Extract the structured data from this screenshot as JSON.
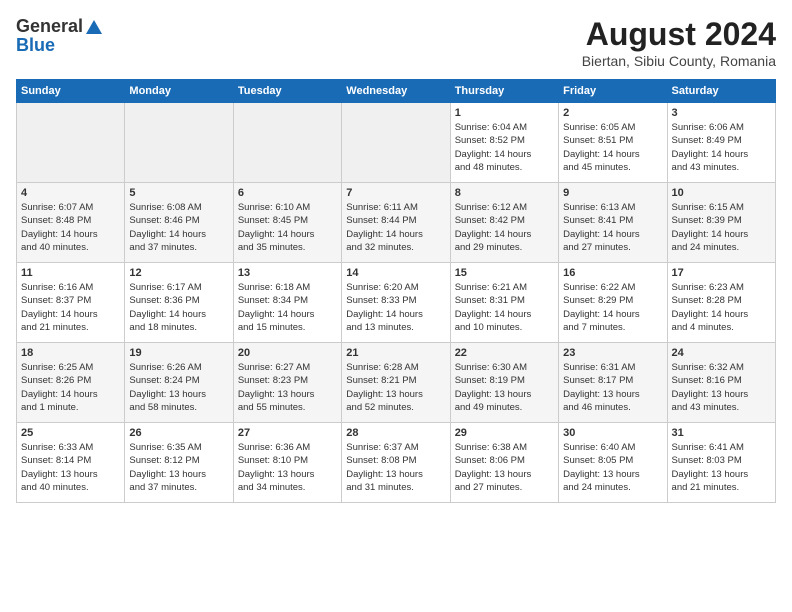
{
  "header": {
    "logo_general": "General",
    "logo_blue": "Blue",
    "month_year": "August 2024",
    "location": "Biertan, Sibiu County, Romania"
  },
  "days_of_week": [
    "Sunday",
    "Monday",
    "Tuesday",
    "Wednesday",
    "Thursday",
    "Friday",
    "Saturday"
  ],
  "weeks": [
    [
      {
        "day": "",
        "info": ""
      },
      {
        "day": "",
        "info": ""
      },
      {
        "day": "",
        "info": ""
      },
      {
        "day": "",
        "info": ""
      },
      {
        "day": "1",
        "info": "Sunrise: 6:04 AM\nSunset: 8:52 PM\nDaylight: 14 hours\nand 48 minutes."
      },
      {
        "day": "2",
        "info": "Sunrise: 6:05 AM\nSunset: 8:51 PM\nDaylight: 14 hours\nand 45 minutes."
      },
      {
        "day": "3",
        "info": "Sunrise: 6:06 AM\nSunset: 8:49 PM\nDaylight: 14 hours\nand 43 minutes."
      }
    ],
    [
      {
        "day": "4",
        "info": "Sunrise: 6:07 AM\nSunset: 8:48 PM\nDaylight: 14 hours\nand 40 minutes."
      },
      {
        "day": "5",
        "info": "Sunrise: 6:08 AM\nSunset: 8:46 PM\nDaylight: 14 hours\nand 37 minutes."
      },
      {
        "day": "6",
        "info": "Sunrise: 6:10 AM\nSunset: 8:45 PM\nDaylight: 14 hours\nand 35 minutes."
      },
      {
        "day": "7",
        "info": "Sunrise: 6:11 AM\nSunset: 8:44 PM\nDaylight: 14 hours\nand 32 minutes."
      },
      {
        "day": "8",
        "info": "Sunrise: 6:12 AM\nSunset: 8:42 PM\nDaylight: 14 hours\nand 29 minutes."
      },
      {
        "day": "9",
        "info": "Sunrise: 6:13 AM\nSunset: 8:41 PM\nDaylight: 14 hours\nand 27 minutes."
      },
      {
        "day": "10",
        "info": "Sunrise: 6:15 AM\nSunset: 8:39 PM\nDaylight: 14 hours\nand 24 minutes."
      }
    ],
    [
      {
        "day": "11",
        "info": "Sunrise: 6:16 AM\nSunset: 8:37 PM\nDaylight: 14 hours\nand 21 minutes."
      },
      {
        "day": "12",
        "info": "Sunrise: 6:17 AM\nSunset: 8:36 PM\nDaylight: 14 hours\nand 18 minutes."
      },
      {
        "day": "13",
        "info": "Sunrise: 6:18 AM\nSunset: 8:34 PM\nDaylight: 14 hours\nand 15 minutes."
      },
      {
        "day": "14",
        "info": "Sunrise: 6:20 AM\nSunset: 8:33 PM\nDaylight: 14 hours\nand 13 minutes."
      },
      {
        "day": "15",
        "info": "Sunrise: 6:21 AM\nSunset: 8:31 PM\nDaylight: 14 hours\nand 10 minutes."
      },
      {
        "day": "16",
        "info": "Sunrise: 6:22 AM\nSunset: 8:29 PM\nDaylight: 14 hours\nand 7 minutes."
      },
      {
        "day": "17",
        "info": "Sunrise: 6:23 AM\nSunset: 8:28 PM\nDaylight: 14 hours\nand 4 minutes."
      }
    ],
    [
      {
        "day": "18",
        "info": "Sunrise: 6:25 AM\nSunset: 8:26 PM\nDaylight: 14 hours\nand 1 minute."
      },
      {
        "day": "19",
        "info": "Sunrise: 6:26 AM\nSunset: 8:24 PM\nDaylight: 13 hours\nand 58 minutes."
      },
      {
        "day": "20",
        "info": "Sunrise: 6:27 AM\nSunset: 8:23 PM\nDaylight: 13 hours\nand 55 minutes."
      },
      {
        "day": "21",
        "info": "Sunrise: 6:28 AM\nSunset: 8:21 PM\nDaylight: 13 hours\nand 52 minutes."
      },
      {
        "day": "22",
        "info": "Sunrise: 6:30 AM\nSunset: 8:19 PM\nDaylight: 13 hours\nand 49 minutes."
      },
      {
        "day": "23",
        "info": "Sunrise: 6:31 AM\nSunset: 8:17 PM\nDaylight: 13 hours\nand 46 minutes."
      },
      {
        "day": "24",
        "info": "Sunrise: 6:32 AM\nSunset: 8:16 PM\nDaylight: 13 hours\nand 43 minutes."
      }
    ],
    [
      {
        "day": "25",
        "info": "Sunrise: 6:33 AM\nSunset: 8:14 PM\nDaylight: 13 hours\nand 40 minutes."
      },
      {
        "day": "26",
        "info": "Sunrise: 6:35 AM\nSunset: 8:12 PM\nDaylight: 13 hours\nand 37 minutes."
      },
      {
        "day": "27",
        "info": "Sunrise: 6:36 AM\nSunset: 8:10 PM\nDaylight: 13 hours\nand 34 minutes."
      },
      {
        "day": "28",
        "info": "Sunrise: 6:37 AM\nSunset: 8:08 PM\nDaylight: 13 hours\nand 31 minutes."
      },
      {
        "day": "29",
        "info": "Sunrise: 6:38 AM\nSunset: 8:06 PM\nDaylight: 13 hours\nand 27 minutes."
      },
      {
        "day": "30",
        "info": "Sunrise: 6:40 AM\nSunset: 8:05 PM\nDaylight: 13 hours\nand 24 minutes."
      },
      {
        "day": "31",
        "info": "Sunrise: 6:41 AM\nSunset: 8:03 PM\nDaylight: 13 hours\nand 21 minutes."
      }
    ]
  ]
}
